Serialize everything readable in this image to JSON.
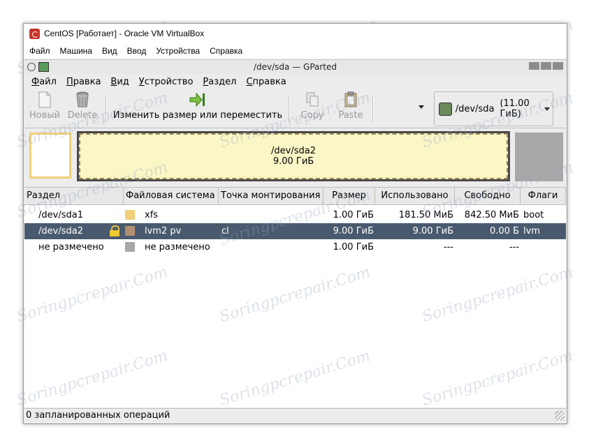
{
  "vbox": {
    "title": "CentOS [Работает] - Oracle VM VirtualBox",
    "menu": [
      "Файл",
      "Машина",
      "Вид",
      "Ввод",
      "Устройства",
      "Справка"
    ]
  },
  "gparted": {
    "title": "/dev/sda — GParted",
    "menu": [
      "Файл",
      "Правка",
      "Вид",
      "Устройство",
      "Раздел",
      "Справка"
    ],
    "toolbar": {
      "new": "Новый",
      "delete": "Delete",
      "resize": "Изменить размер или переместить",
      "copy": "Copy",
      "paste": "Paste"
    },
    "device": {
      "name": "/dev/sda",
      "size": "(11.00 ГиБ)"
    },
    "diskmap": {
      "main_name": "/dev/sda2",
      "main_size": "9.00 ГиБ"
    },
    "columns": [
      "Раздел",
      "Файловая система",
      "Точка монтирования",
      "Размер",
      "Использовано",
      "Свободно",
      "Флаги"
    ],
    "rows": [
      {
        "partition": "/dev/sda1",
        "fs": "xfs",
        "mount": "",
        "size": "1.00 ГиБ",
        "used": "181.50 МиБ",
        "free": "842.50 МиБ",
        "flags": "boot",
        "color": "#f0d078",
        "locked": false,
        "selected": false
      },
      {
        "partition": "/dev/sda2",
        "fs": "lvm2 pv",
        "mount": "cl",
        "size": "9.00 ГиБ",
        "used": "9.00 ГиБ",
        "free": "0.00 Б",
        "flags": "lvm",
        "color": "#b09070",
        "locked": true,
        "selected": true
      },
      {
        "partition": "не размечено",
        "fs": "не размечено",
        "mount": "",
        "size": "1.00 ГиБ",
        "used": "---",
        "free": "---",
        "flags": "",
        "color": "#a8a8a8",
        "locked": false,
        "selected": false
      }
    ],
    "status": "0 запланированных операций"
  },
  "watermark": "Soringpcrepair.Com"
}
